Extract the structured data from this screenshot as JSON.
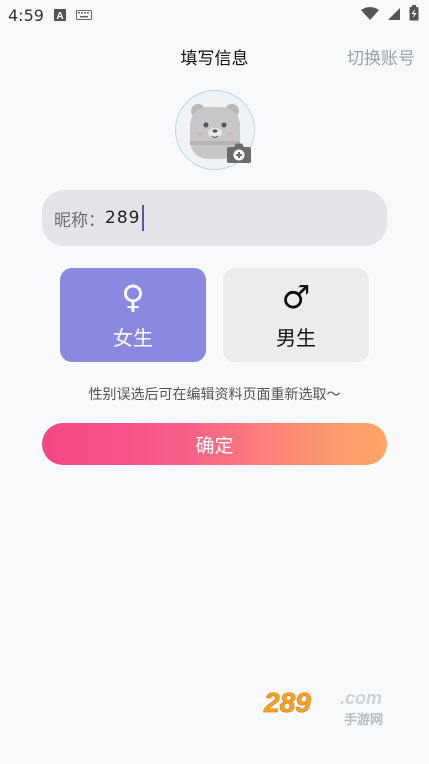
{
  "status_bar": {
    "time": "4:59",
    "icons": [
      "a-badge-icon",
      "keyboard-icon",
      "wifi-icon",
      "cellular-icon",
      "battery-charging-icon"
    ]
  },
  "header": {
    "title": "填写信息",
    "switch_account": "切换账号"
  },
  "avatar": {
    "icon": "bear-avatar-icon",
    "badge_icon": "camera-add-icon"
  },
  "nickname": {
    "label": "昵称：",
    "value": "289"
  },
  "gender": {
    "female": {
      "symbol": "♀",
      "label": "女生",
      "selected": true,
      "color": "#8a89e0"
    },
    "male": {
      "symbol": "♂",
      "label": "男生",
      "selected": false,
      "color": "#ececee"
    }
  },
  "hint": "性别误选后可在编辑资料页面重新选取～",
  "confirm_button": {
    "label": "确定",
    "gradient": [
      "#f44784",
      "#fca664"
    ]
  },
  "watermark": {
    "text": "289.com 手游网"
  },
  "colors": {
    "background": "#f8f9fa",
    "field_bg": "#e4e3e8",
    "accent": "#8a89e0",
    "muted_text": "#9aa0a8"
  }
}
